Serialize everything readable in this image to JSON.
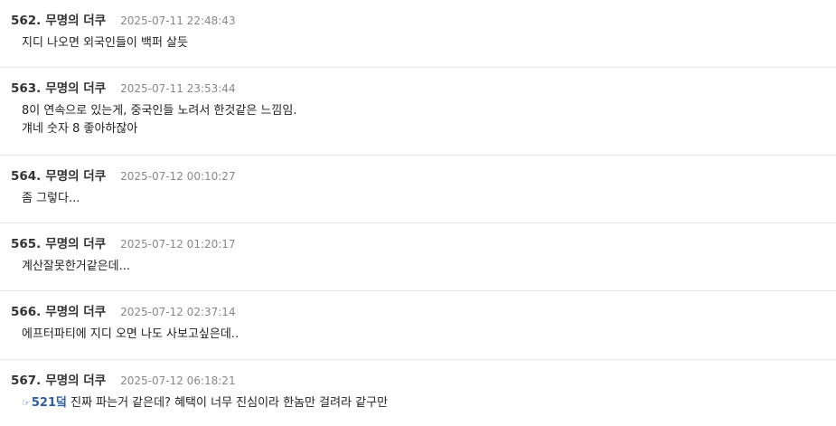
{
  "posts": [
    {
      "number": "562.",
      "author": "무명의 더쿠",
      "date": "2025-07-11 22:48:43",
      "lines": [
        "지디 나오면 외국인들이 백퍼 살듯"
      ]
    },
    {
      "number": "563.",
      "author": "무명의 더쿠",
      "date": "2025-07-11 23:53:44",
      "lines": [
        "8이 연속으로 있는게, 중국인들 노려서 한것같은 느낌임.",
        "걔네 숫자 8 좋아하잖아"
      ]
    },
    {
      "number": "564.",
      "author": "무명의 더쿠",
      "date": "2025-07-12 00:10:27",
      "lines": [
        "좀 그렇다..."
      ]
    },
    {
      "number": "565.",
      "author": "무명의 더쿠",
      "date": "2025-07-12 01:20:17",
      "lines": [
        "계산잘못한거같은데..."
      ]
    },
    {
      "number": "566.",
      "author": "무명의 더쿠",
      "date": "2025-07-12 02:37:14",
      "lines": [
        "에프터파티에 지디 오면 나도 사보고싶은데.."
      ]
    },
    {
      "number": "567.",
      "author": "무명의 더쿠",
      "date": "2025-07-12 06:18:21",
      "anchor_icon": "☞",
      "anchor_label": "521덬",
      "anchor_icon_name": "pointing-hand-icon",
      "anchor_rest": " 진짜 파는거 같은데? 혜택이 너무 진심이라 한놈만 걸려라 같구만"
    }
  ]
}
